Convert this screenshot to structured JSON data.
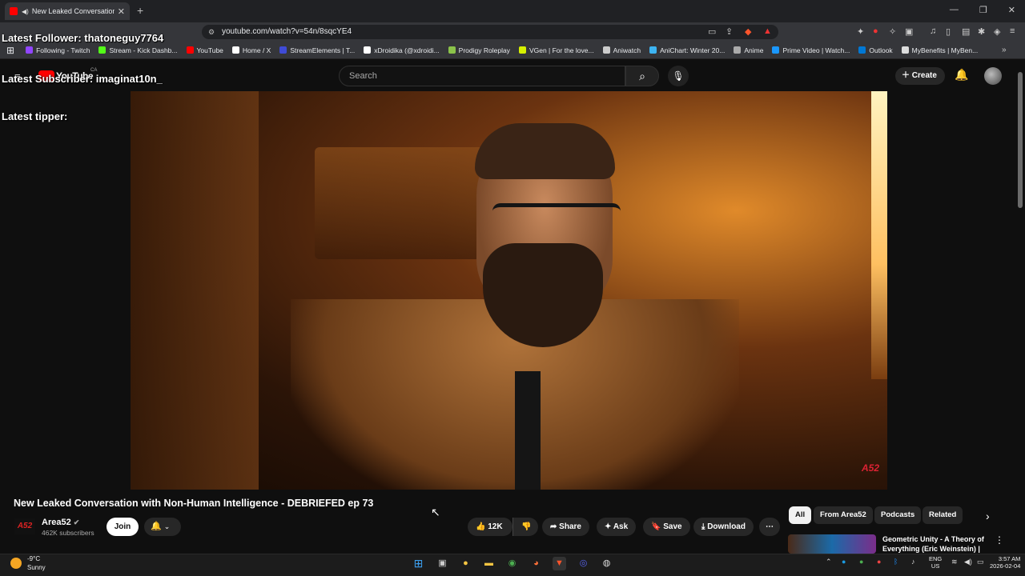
{
  "browser": {
    "tab_title": "New Leaked Conversation wi",
    "url": "youtube.com/watch?v=54n/8sqcYE4",
    "bookmarks": [
      {
        "label": "Following - Twitch",
        "color": "#9146ff"
      },
      {
        "label": "Stream - Kick Dashb...",
        "color": "#53fc18"
      },
      {
        "label": "YouTube",
        "color": "#ff0000"
      },
      {
        "label": "Home / X",
        "color": "#ffffff"
      },
      {
        "label": "StreamElements | T...",
        "color": "#3f4bd6"
      },
      {
        "label": "xDroidika (@xdroidi...",
        "color": "#ffffff"
      },
      {
        "label": "Prodigy Roleplay",
        "color": "#8bc34a"
      },
      {
        "label": "VGen | For the love...",
        "color": "#d6f000"
      },
      {
        "label": "Aniwatch",
        "color": "#cccccc"
      },
      {
        "label": "AniChart: Winter 20...",
        "color": "#3db4f2"
      },
      {
        "label": "Anime",
        "color": "#aaaaaa"
      },
      {
        "label": "Prime Video | Watch...",
        "color": "#1a98ff"
      },
      {
        "label": "Outlook",
        "color": "#0078d4"
      },
      {
        "label": "MyBenefits | MyBen...",
        "color": "#dddddd"
      }
    ]
  },
  "overlay": {
    "latest_follower": "Latest Follower: thatoneguy7764",
    "latest_subscriber": "Latest Subscriber: imaginat10n_",
    "latest_tipper": "Latest tipper:"
  },
  "youtube": {
    "logo_text": "YouTube",
    "region": "CA",
    "search_placeholder": "Search",
    "create_label": "Create",
    "video_title": "New Leaked Conversation with Non-Human Intelligence - DEBRIEFED ep 73",
    "channel": {
      "name": "Area52",
      "subscribers": "462K subscribers",
      "logo": "A52"
    },
    "join_label": "Join",
    "actions": {
      "likes": "12K",
      "share": "Share",
      "ask": "Ask",
      "save": "Save",
      "download": "Download"
    },
    "chips": [
      "All",
      "From Area52",
      "Podcasts",
      "Related"
    ],
    "recommendation": {
      "title": "Geometric Unity - A Theory of Everything (Eric Weinstein) | AI"
    },
    "watermark": "A52"
  },
  "taskbar": {
    "temperature": "-9°C",
    "condition": "Sunny",
    "lang": "ENG",
    "region": "US",
    "time": "3:57 AM",
    "date": "2026-02-04"
  }
}
